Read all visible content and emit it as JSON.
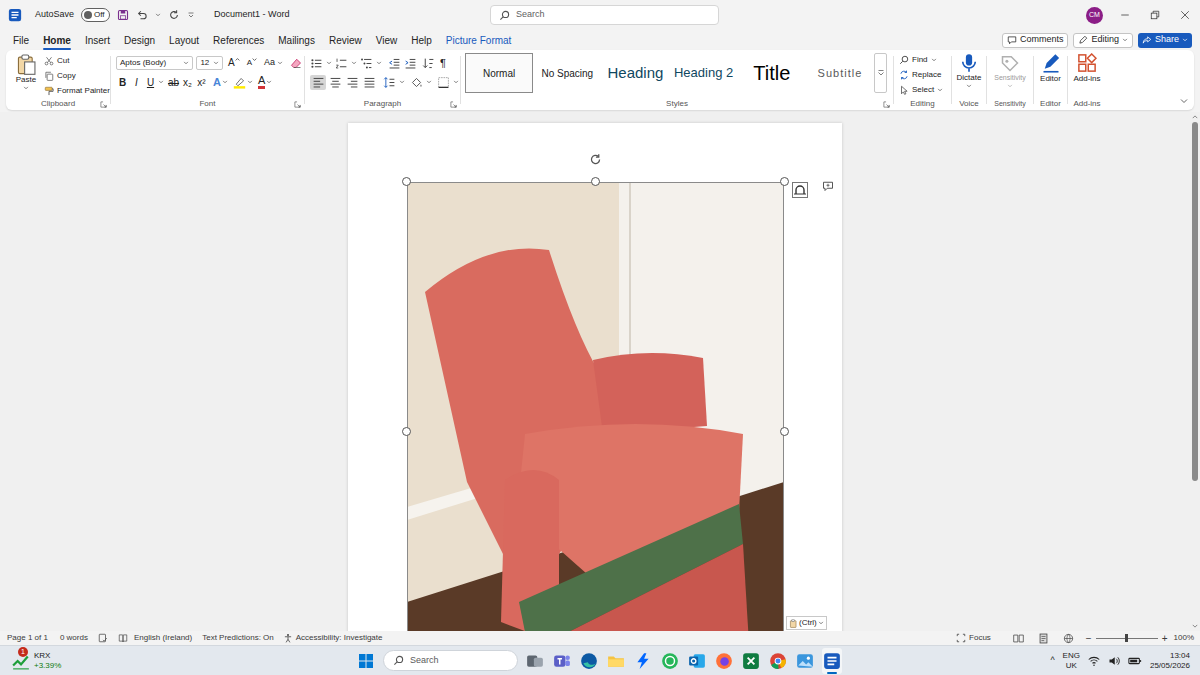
{
  "title_bar": {
    "autosave": {
      "label": "AutoSave",
      "state": "Off",
      "on": false
    },
    "document_title": "Document1 - Word",
    "search": {
      "placeholder": "Search"
    },
    "avatar": "CM"
  },
  "tabs": [
    {
      "label": "File",
      "selected": false,
      "contextual": false
    },
    {
      "label": "Home",
      "selected": true,
      "contextual": false
    },
    {
      "label": "Insert",
      "selected": false,
      "contextual": false
    },
    {
      "label": "Design",
      "selected": false,
      "contextual": false
    },
    {
      "label": "Layout",
      "selected": false,
      "contextual": false
    },
    {
      "label": "References",
      "selected": false,
      "contextual": false
    },
    {
      "label": "Mailings",
      "selected": false,
      "contextual": false
    },
    {
      "label": "Review",
      "selected": false,
      "contextual": false
    },
    {
      "label": "View",
      "selected": false,
      "contextual": false
    },
    {
      "label": "Help",
      "selected": false,
      "contextual": false
    },
    {
      "label": "Picture Format",
      "selected": false,
      "contextual": true
    }
  ],
  "actions": {
    "comments": "Comments",
    "editing": "Editing",
    "share": "Share"
  },
  "clipboard": {
    "paste": "Paste",
    "cut": "Cut",
    "copy": "Copy",
    "format_painter": "Format Painter",
    "label": "Clipboard"
  },
  "font": {
    "name": "Aptos (Body)",
    "size": "12",
    "grow": "A",
    "shrink": "A",
    "change_case": "Aa",
    "buttons": [
      {
        "label": "B",
        "kind": "bold"
      },
      {
        "label": "I",
        "kind": "italic"
      },
      {
        "label": "U",
        "kind": "underline"
      },
      {
        "label": "ab",
        "kind": "strike"
      },
      {
        "label": "x₂",
        "kind": "sub"
      },
      {
        "label": "x²",
        "kind": "sup"
      }
    ],
    "effects": "A",
    "color": "A",
    "label": "Font"
  },
  "paragraph": {
    "pilcrow": "¶",
    "alignment": [
      {
        "kind": "left",
        "selected": true
      },
      {
        "kind": "center",
        "selected": false
      },
      {
        "kind": "right",
        "selected": false
      },
      {
        "kind": "justify",
        "selected": false
      }
    ],
    "label": "Paragraph"
  },
  "styles": {
    "items": [
      {
        "label": "Normal",
        "kind": "normal",
        "selected": true
      },
      {
        "label": "No Spacing",
        "kind": "nospacing",
        "selected": false
      },
      {
        "label": "Heading",
        "kind": "heading",
        "selected": false
      },
      {
        "label": "Heading 2",
        "kind": "heading2",
        "selected": false
      },
      {
        "label": "Title",
        "kind": "title",
        "selected": false
      },
      {
        "label": "Subtitle",
        "kind": "subtitle",
        "selected": false
      }
    ],
    "label": "Styles"
  },
  "editing": {
    "find": "Find",
    "replace": "Replace",
    "select": "Select",
    "label": "Editing"
  },
  "voice": {
    "dictate": "Dictate",
    "label": "Voice"
  },
  "sensitivity": {
    "button": "Sensitivity",
    "disabled": true,
    "label": "Sensitivity"
  },
  "editor": {
    "button": "Editor",
    "label": "Editor"
  },
  "addins": {
    "button": "Add-ins",
    "label": "Add-ins"
  },
  "picture": {
    "selected": true
  },
  "paste_options": {
    "label": "(Ctrl)"
  },
  "scrollbar": {
    "position": 0,
    "visible_share": 0.72
  },
  "status_bar": {
    "page": "Page 1 of 1",
    "words": "0 words",
    "language": "English (Ireland)",
    "predictions": "Text Predictions: On",
    "accessibility": "Accessibility: Investigate",
    "focus": "Focus",
    "zoom": {
      "minus": "−",
      "plus": "+",
      "reading": "100%",
      "level": 0.5
    }
  },
  "taskbar": {
    "widget": {
      "ticker": "KRX",
      "change": "+3.39%",
      "badge": "1"
    },
    "search": {
      "placeholder": "Search"
    },
    "apps": [
      {
        "active": false
      },
      {
        "active": false
      },
      {
        "active": false
      },
      {
        "active": false
      },
      {
        "active": false
      },
      {
        "active": false
      },
      {
        "active": false
      },
      {
        "active": false
      },
      {
        "active": false
      },
      {
        "active": false
      },
      {
        "active": false
      },
      {
        "active": true
      }
    ],
    "tray": {
      "chevron": "^",
      "language": "ENG",
      "region": "UK",
      "time": "13:04",
      "date": "25/05/2026"
    }
  }
}
